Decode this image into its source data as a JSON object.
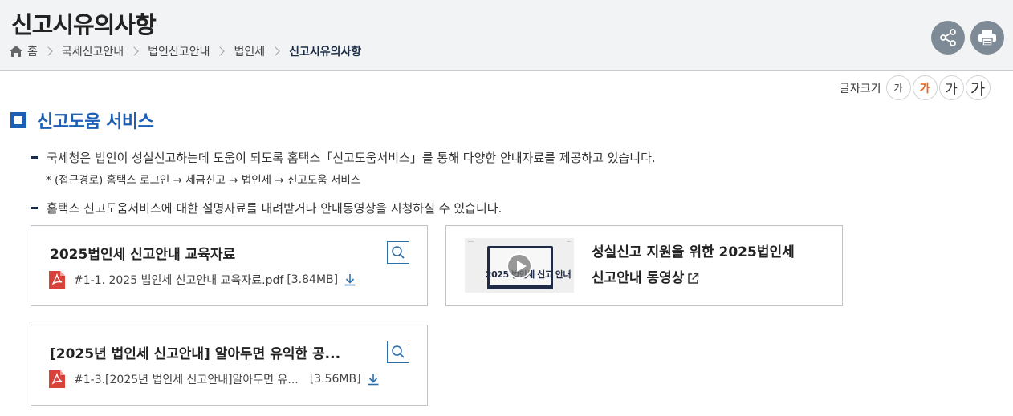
{
  "header": {
    "title": "신고시유의사항",
    "breadcrumb": [
      "홈",
      "국세신고안내",
      "법인신고안내",
      "법인세",
      "신고시유의사항"
    ]
  },
  "font_size": {
    "label": "글자크기",
    "options": [
      "가",
      "가",
      "가",
      "가"
    ],
    "selected_index": 1
  },
  "section": {
    "title": "신고도움 서비스",
    "bullet1": "국세청은 법인이 성실신고하는데 도움이 되도록 홈택스「신고도움서비스」를 통해 다양한 안내자료를 제공하고 있습니다.",
    "note": "* (접근경로) 홈택스 로그인 → 세금신고 → 법인세 → 신고도움 서비스",
    "bullet2": "홈택스 신고도움서비스에 대한 설명자료를 내려받거나 안내동영상을 시청하실 수 있습니다."
  },
  "cards": [
    {
      "title": "2025법인세 신고안내 교육자료",
      "file_name": "#1-1. 2025 법인세 신고안내 교육자료.pdf",
      "file_size": "[3.84MB]"
    },
    {
      "title": "[2025년 법인세 신고안내] 알아두면 유익한 공...",
      "file_name": "#1-3.[2025년 법인세 신고안내]알아두면 유...",
      "file_size": "[3.56MB]"
    }
  ],
  "video": {
    "title_line1": "성실신고 지원을 위한 2025법인세",
    "title_line2": "신고안내 동영상",
    "thumb_text": "2025 법인세 신고 안내"
  },
  "colors": {
    "accent_blue": "#1c5fb5",
    "selected_font_size": "#e8651a",
    "pdf_red": "#d9423b",
    "circle_button": "#7e8a95"
  },
  "icons": [
    "home-icon",
    "share-icon",
    "print-icon",
    "zoom-icon",
    "pdf-icon",
    "download-icon",
    "play-icon",
    "external-link-icon"
  ]
}
